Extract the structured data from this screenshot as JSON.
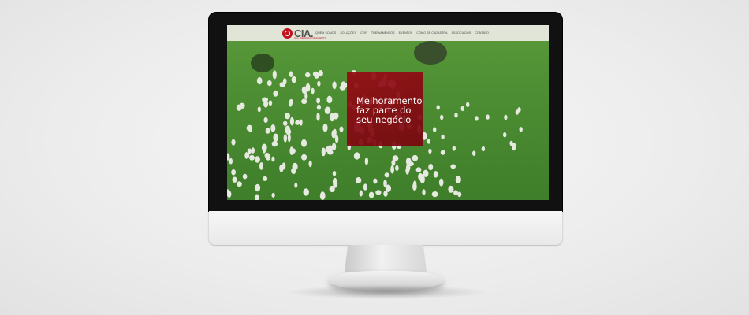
{
  "site": {
    "logo_text": "CIA.",
    "logo_tagline": "CIA. DE MELHORAMENTO",
    "nav": [
      "QUEM SOMOS",
      "SOLUÇÕES",
      "CEIP",
      "TREINAMENTOS",
      "EVENTOS",
      "COMO SE CADASTRA",
      "ASSOCIADOS",
      "CONTATO"
    ]
  },
  "hero": {
    "line1": "Melhoramento",
    "line2": "faz parte do",
    "line3": "seu negócio"
  },
  "colors": {
    "brand_red": "#c1121f",
    "grass": "#4e8f34"
  }
}
